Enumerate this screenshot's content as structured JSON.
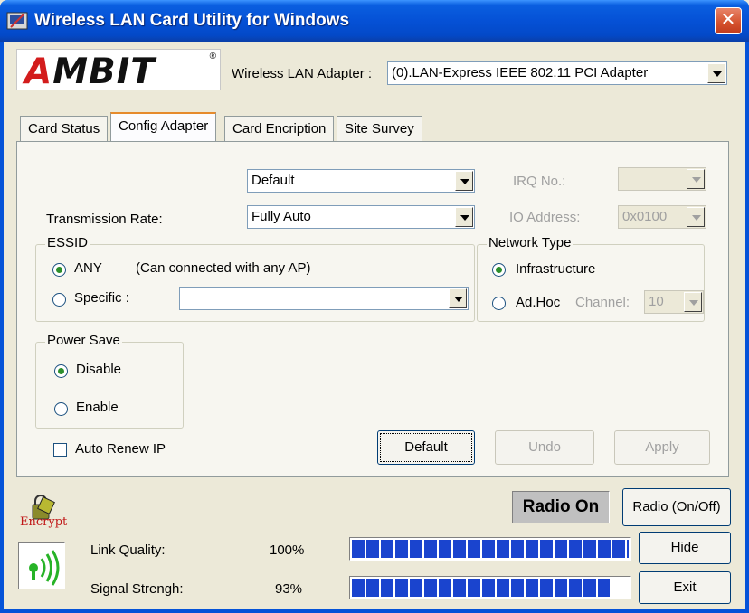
{
  "window": {
    "title": "Wireless LAN Card Utility for Windows",
    "close_glyph": "✕"
  },
  "logo": {
    "text": "AMBIT",
    "reg": "®"
  },
  "adapter": {
    "label": "Wireless LAN Adapter :",
    "value": "(0).LAN-Express IEEE 802.11 PCI Adapter"
  },
  "tabs": [
    {
      "label": "Card Status",
      "active": false
    },
    {
      "label": "Config Adapter",
      "active": true
    },
    {
      "label": "Card Encription",
      "active": false
    },
    {
      "label": "Site Survey",
      "active": false
    }
  ],
  "config": {
    "profile_value": "Default",
    "transmission_rate_label": "Transmission Rate:",
    "transmission_rate_value": "Fully Auto",
    "irq_label": "IRQ No.:",
    "irq_value": "",
    "io_label": "IO Address:",
    "io_value": "0x0100",
    "essid": {
      "title": "ESSID",
      "any_label": "ANY",
      "any_note": "(Can connected with any AP)",
      "specific_label": "Specific :",
      "specific_value": "",
      "selected": "any"
    },
    "network_type": {
      "title": "Network Type",
      "infrastructure_label": "Infrastructure",
      "adhoc_label": "Ad.Hoc",
      "channel_label": "Channel:",
      "channel_value": "10",
      "selected": "infrastructure"
    },
    "power_save": {
      "title": "Power Save",
      "disable_label": "Disable",
      "enable_label": "Enable",
      "selected": "disable"
    },
    "auto_renew_label": "Auto Renew IP",
    "auto_renew_checked": false,
    "buttons": {
      "default": "Default",
      "undo": "Undo",
      "apply": "Apply"
    }
  },
  "status": {
    "encrypt_icon_text": "Encrypt",
    "radio_state": "Radio On",
    "radio_toggle_label": "Radio (On/Off)",
    "hide_label": "Hide",
    "exit_label": "Exit",
    "link_quality_label": "Link Quality:",
    "link_quality_value": "100%",
    "link_quality_level": 100,
    "signal_label": "Signal Strengh:",
    "signal_value": "93%",
    "signal_level": 93
  },
  "colors": {
    "title_bar": "#0553d8",
    "meter_fill": "#1a44ce",
    "logo_accent": "#d31c1c"
  }
}
